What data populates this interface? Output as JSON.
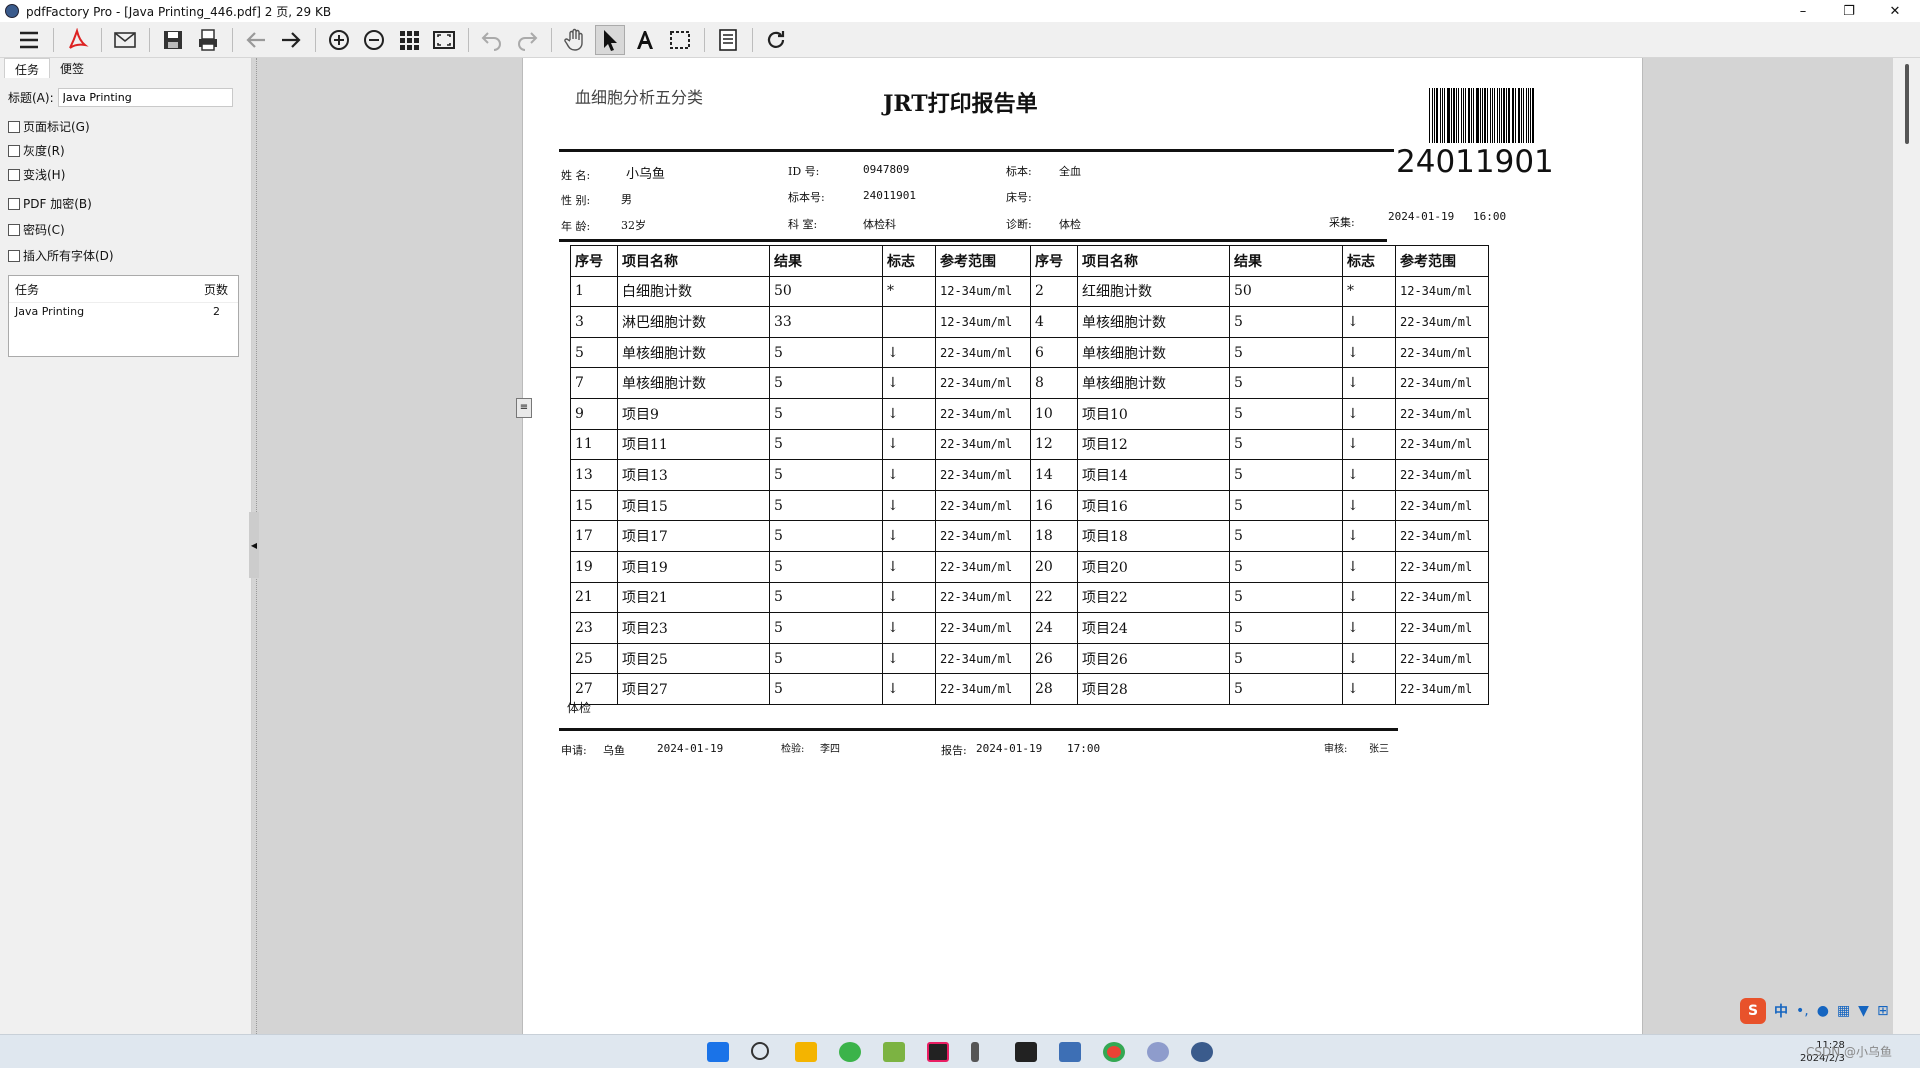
{
  "window": {
    "title": "pdfFactory Pro - [Java Printing_446.pdf] 2 页, 29 KB",
    "minimize": "–",
    "maximize": "❐",
    "close": "✕"
  },
  "toolbar": {
    "icons": [
      "menu-icon",
      "pdf-icon",
      "email-icon",
      "save-icon",
      "print-icon",
      "arrow-left-icon",
      "arrow-right-icon",
      "zoom-in-icon",
      "zoom-out-icon",
      "thumbnails-icon",
      "fit-page-icon",
      "undo-icon",
      "redo-icon",
      "hand-icon",
      "select-arrow-icon",
      "text-select-icon",
      "marquee-icon",
      "notes-icon",
      "refresh-icon"
    ]
  },
  "panel": {
    "tabs": [
      "任务",
      "便签"
    ],
    "title_label": "标题(A):",
    "title_value": "Java Printing",
    "options": [
      "页面标记(G)",
      "灰度(R)",
      "变浅(H)",
      "PDF 加密(B)",
      "密码(C)",
      "插入所有字体(D)"
    ],
    "task_header": "任务",
    "pages_header": "页数",
    "task_name": "Java Printing",
    "task_pages": "2"
  },
  "report": {
    "subtitle": "血细胞分析五分类",
    "title": "JRT打印报告单",
    "barcode": "24011901",
    "name_label": "姓  名:",
    "name": "小乌鱼",
    "id_label": "ID   号:",
    "id": "0947809",
    "specimen_label": "标本:",
    "specimen": "全血",
    "sex_label": "性  别:",
    "sex": "男",
    "specno_label": "标本号:",
    "specno": "24011901",
    "bed_label": "床号:",
    "age_label": "年  龄:",
    "age": "32岁",
    "dept_label": "科   室:",
    "dept": "体检科",
    "diag_label": "诊断:",
    "diag": "体检",
    "collect_label": "采集:",
    "collect_date": "2024-01-19",
    "collect_time": "16:00",
    "headers": [
      "序号",
      "项目名称",
      "结果",
      "标志",
      "参考范围",
      "序号",
      "项目名称",
      "结果",
      "标志",
      "参考范围"
    ],
    "rows": [
      [
        "1",
        "白细胞计数",
        "50",
        "*",
        "12-34um/ml",
        "2",
        "红细胞计数",
        "50",
        "*",
        "12-34um/ml"
      ],
      [
        "3",
        "淋巴细胞计数",
        "33",
        "",
        "12-34um/ml",
        "4",
        "单核细胞计数",
        "5",
        "↓",
        "22-34um/ml"
      ],
      [
        "5",
        "单核细胞计数",
        "5",
        "↓",
        "22-34um/ml",
        "6",
        "单核细胞计数",
        "5",
        "↓",
        "22-34um/ml"
      ],
      [
        "7",
        "单核细胞计数",
        "5",
        "↓",
        "22-34um/ml",
        "8",
        "单核细胞计数",
        "5",
        "↓",
        "22-34um/ml"
      ],
      [
        "9",
        "项目9",
        "5",
        "↓",
        "22-34um/ml",
        "10",
        "项目10",
        "5",
        "↓",
        "22-34um/ml"
      ],
      [
        "11",
        "项目11",
        "5",
        "↓",
        "22-34um/ml",
        "12",
        "项目12",
        "5",
        "↓",
        "22-34um/ml"
      ],
      [
        "13",
        "项目13",
        "5",
        "↓",
        "22-34um/ml",
        "14",
        "项目14",
        "5",
        "↓",
        "22-34um/ml"
      ],
      [
        "15",
        "项目15",
        "5",
        "↓",
        "22-34um/ml",
        "16",
        "项目16",
        "5",
        "↓",
        "22-34um/ml"
      ],
      [
        "17",
        "项目17",
        "5",
        "↓",
        "22-34um/ml",
        "18",
        "项目18",
        "5",
        "↓",
        "22-34um/ml"
      ],
      [
        "19",
        "项目19",
        "5",
        "↓",
        "22-34um/ml",
        "20",
        "项目20",
        "5",
        "↓",
        "22-34um/ml"
      ],
      [
        "21",
        "项目21",
        "5",
        "↓",
        "22-34um/ml",
        "22",
        "项目22",
        "5",
        "↓",
        "22-34um/ml"
      ],
      [
        "23",
        "项目23",
        "5",
        "↓",
        "22-34um/ml",
        "24",
        "项目24",
        "5",
        "↓",
        "22-34um/ml"
      ],
      [
        "25",
        "项目25",
        "5",
        "↓",
        "22-34um/ml",
        "26",
        "项目26",
        "5",
        "↓",
        "22-34um/ml"
      ],
      [
        "27",
        "项目27",
        "5",
        "↓",
        "22-34um/ml",
        "28",
        "项目28",
        "5",
        "↓",
        "22-34um/ml"
      ]
    ],
    "remark": "体检",
    "apply_label": "申请:",
    "apply_person": "乌鱼",
    "apply_date": "2024-01-19",
    "test_label": "检验:",
    "test_person": "李四",
    "report_label": "报告:",
    "report_date": "2024-01-19",
    "report_time": "17:00",
    "audit_label": "审核:",
    "audit_person": "张三"
  },
  "taskbar": {
    "icons": [
      "windows-start-icon",
      "search-icon",
      "file-explorer-icon",
      "edge-browser-icon",
      "notepad-icon",
      "jetbrains-icon",
      "figure-icon",
      "terminal-icon",
      "hbuilder-icon",
      "chrome-icon",
      "network-app-icon",
      "pdffactory-icon"
    ],
    "tray": [
      "sogou-ime-icon",
      "中",
      "•,",
      "microphone-icon",
      "keyboard-icon",
      "shirt-icon",
      "grid-icon"
    ],
    "time": "11:28",
    "date": "2024/2/3",
    "watermark": "CSDN @小乌鱼"
  }
}
